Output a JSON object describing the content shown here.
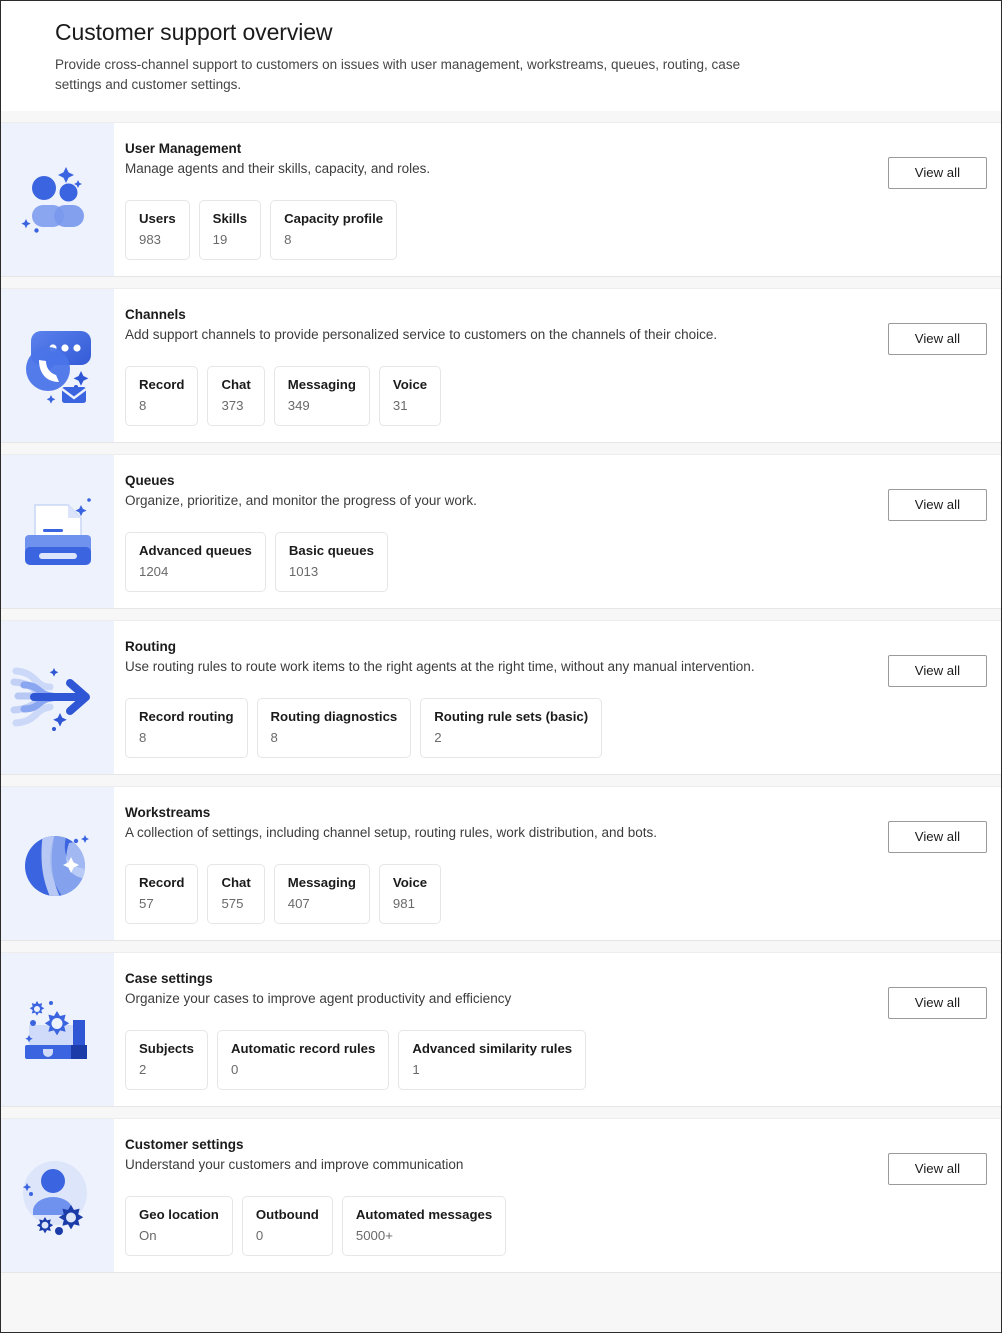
{
  "header": {
    "title": "Customer support overview",
    "subtitle": "Provide cross-channel support to customers on issues with user management, workstreams, queues, routing, case settings and customer settings."
  },
  "common": {
    "view_all_label": "View all",
    "accent_color": "#3b64e0",
    "icon_panel_color": "#eef2fd",
    "page_background": "#f7f7f7",
    "card_background": "#ffffff"
  },
  "cards": [
    {
      "id": "user-management",
      "icon": "people-icon",
      "title": "User Management",
      "description": "Manage agents and their skills, capacity, and roles.",
      "view_all_label": "View all",
      "stats": [
        {
          "label": "Users",
          "value": "983"
        },
        {
          "label": "Skills",
          "value": "19"
        },
        {
          "label": "Capacity profile",
          "value": "8"
        }
      ]
    },
    {
      "id": "channels",
      "icon": "chat-phone-mail-icon",
      "title": "Channels",
      "description": "Add support channels to provide personalized service to customers on the channels of their choice.",
      "view_all_label": "View all",
      "stats": [
        {
          "label": "Record",
          "value": "8"
        },
        {
          "label": "Chat",
          "value": "373"
        },
        {
          "label": "Messaging",
          "value": "349"
        },
        {
          "label": "Voice",
          "value": "31"
        }
      ]
    },
    {
      "id": "queues",
      "icon": "document-tray-icon",
      "title": "Queues",
      "description": "Organize, prioritize, and monitor the progress of your work.",
      "view_all_label": "View all",
      "stats": [
        {
          "label": "Advanced queues",
          "value": "1204"
        },
        {
          "label": "Basic queues",
          "value": "1013"
        }
      ]
    },
    {
      "id": "routing",
      "icon": "arrow-flow-icon",
      "title": "Routing",
      "description": "Use routing rules to route work items to the right agents at the right time, without any manual intervention.",
      "view_all_label": "View all",
      "stats": [
        {
          "label": "Record routing",
          "value": "8"
        },
        {
          "label": "Routing diagnostics",
          "value": "8"
        },
        {
          "label": "Routing rule sets (basic)",
          "value": "2"
        }
      ]
    },
    {
      "id": "workstreams",
      "icon": "sphere-icon",
      "title": "Workstreams",
      "description": "A collection of settings, including channel setup, routing rules, work distribution, and bots.",
      "view_all_label": "View all",
      "stats": [
        {
          "label": "Record",
          "value": "57"
        },
        {
          "label": "Chat",
          "value": "575"
        },
        {
          "label": "Messaging",
          "value": "407"
        },
        {
          "label": "Voice",
          "value": "981"
        }
      ]
    },
    {
      "id": "case-settings",
      "icon": "briefcase-gear-icon",
      "title": "Case settings",
      "description": "Organize your cases to improve agent productivity and efficiency",
      "view_all_label": "View all",
      "stats": [
        {
          "label": "Subjects",
          "value": "2"
        },
        {
          "label": "Automatic record rules",
          "value": "0"
        },
        {
          "label": "Advanced similarity rules",
          "value": "1"
        }
      ]
    },
    {
      "id": "customer-settings",
      "icon": "person-gear-icon",
      "title": "Customer settings",
      "description": "Understand your customers and improve communication",
      "view_all_label": "View all",
      "stats": [
        {
          "label": "Geo location",
          "value": "On"
        },
        {
          "label": "Outbound",
          "value": "0"
        },
        {
          "label": "Automated messages",
          "value": "5000+"
        }
      ]
    }
  ]
}
